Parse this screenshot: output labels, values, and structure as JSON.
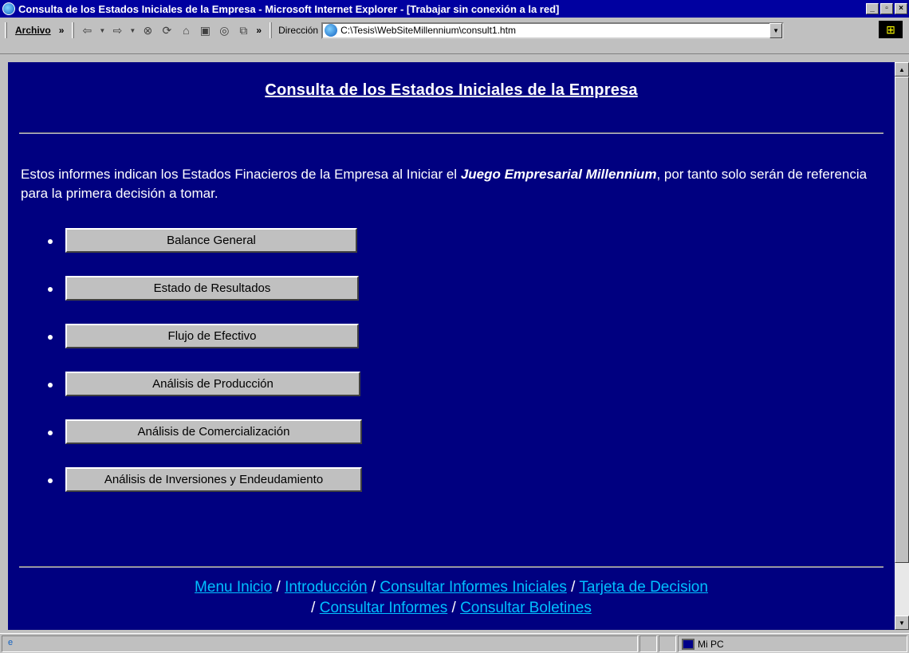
{
  "window": {
    "title": "Consulta de los Estados Iniciales de la Empresa - Microsoft Internet Explorer - [Trabajar sin conexión a la red]",
    "minimize": "_",
    "maximize": "▫",
    "close": "×"
  },
  "toolbar": {
    "menu_archivo": "Archivo",
    "chevron": "»",
    "address_label": "Dirección",
    "address_value": "C:\\Tesis\\WebSiteMillennium\\consult1.htm"
  },
  "page": {
    "title": "Consulta de los Estados Iniciales de la Empresa",
    "intro_pre": "Estos informes indican los Estados Finacieros de la Empresa al Iniciar el ",
    "intro_bold": "Juego Empresarial Millennium",
    "intro_post": ", por tanto solo serán de referencia para la primera decisión a tomar.",
    "buttons": [
      "Balance General",
      "Estado de Resultados",
      "Flujo de Efectivo",
      "Análisis de Producción",
      "Análisis de Comercialización",
      "Análisis de Inversiones y Endeudamiento"
    ],
    "footer_links": [
      "Menu Inicio",
      "Introducción",
      "Consultar Informes Iniciales",
      "Tarjeta de Decision",
      "Consultar Informes",
      "Consultar Boletines"
    ],
    "separator": " / "
  },
  "status": {
    "zone": "Mi PC"
  }
}
